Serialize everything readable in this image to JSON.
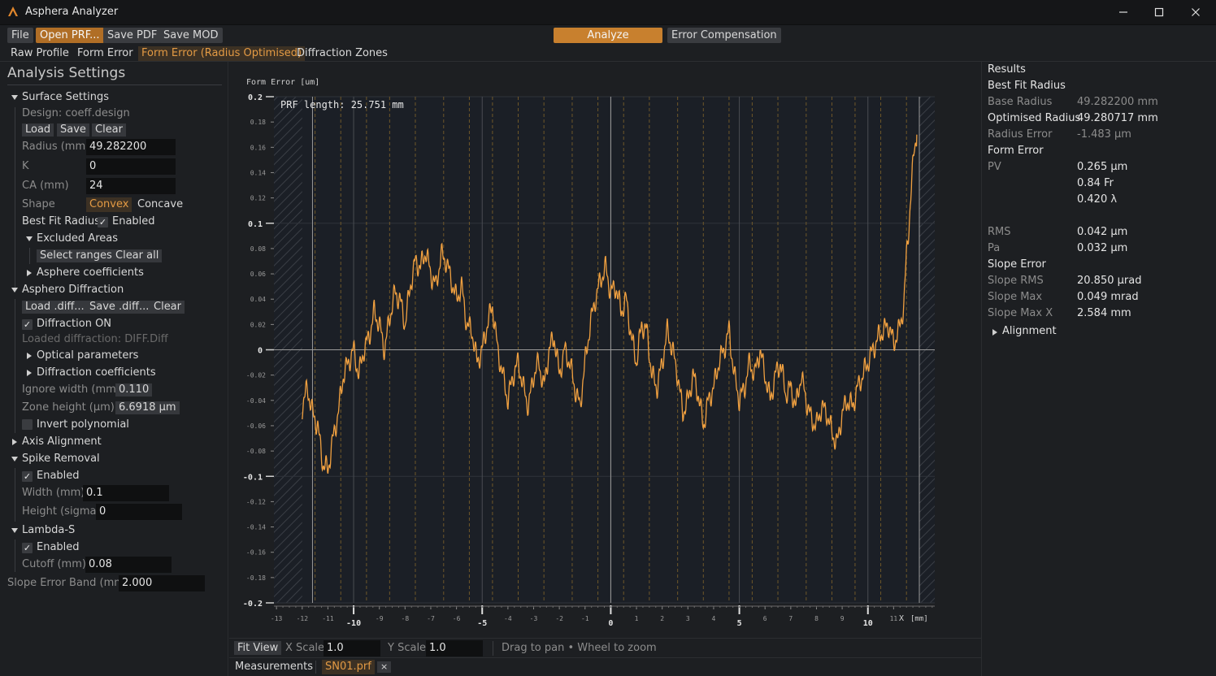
{
  "window": {
    "title": "Asphera Analyzer",
    "accent_color": "#c8802e",
    "controls": {
      "minimize": "minimize-icon",
      "maximize": "maximize-icon",
      "close": "close-icon"
    }
  },
  "toolbar": {
    "file": "File",
    "open_prf": "Open PRF...",
    "save_pdf": "Save PDF",
    "save_mod": "Save MOD",
    "analyze": "Analyze",
    "error_compensation": "Error Compensation"
  },
  "tabs": [
    "Raw Profile",
    "Form Error",
    "Form Error (Radius Optimised)",
    "Diffraction Zones"
  ],
  "active_tab": "Form Error (Radius Optimised)",
  "left": {
    "heading": "Analysis Settings",
    "surface": {
      "title": "Surface Settings",
      "design": "Design: coeff.design",
      "load": "Load",
      "save": "Save",
      "clear": "Clear",
      "radius_label": "Radius (mm)",
      "radius": "49.282200",
      "k_label": "K",
      "k": "0",
      "ca_label": "CA (mm)",
      "ca": "24",
      "shape_label": "Shape",
      "shape_convex": "Convex",
      "shape_concave": "Concave",
      "shape_selected": "Convex",
      "best_fit_label": "Best Fit Radius",
      "best_fit_enabled": "Enabled",
      "best_fit_checked": true,
      "excluded_title": "Excluded Areas",
      "select_ranges": "Select ranges",
      "clear_all": "Clear all",
      "asphere_coeffs": "Asphere coefficients"
    },
    "diffraction": {
      "title": "Asphero Diffraction",
      "load": "Load .diff...",
      "save": "Save .diff...",
      "clear": "Clear",
      "on_label": "Diffraction ON",
      "on_checked": true,
      "loaded": "Loaded diffraction: DIFF.Diff",
      "optical": "Optical parameters",
      "coeffs": "Diffraction coefficients",
      "ignore_label": "Ignore width (mm)",
      "ignore": "0.110",
      "zone_label": "Zone height (µm)",
      "zone": "6.6918 µm",
      "invert_label": "Invert polynomial",
      "invert_checked": false
    },
    "axis_alignment": "Axis Alignment",
    "spike": {
      "title": "Spike Removal",
      "enabled": "Enabled",
      "checked": true,
      "width_label": "Width (mm)",
      "width": "0.1",
      "height_label": "Height (sigma)",
      "height": "0"
    },
    "lambda": {
      "title": "Lambda-S",
      "enabled": "Enabled",
      "checked": true,
      "cutoff_label": "Cutoff (mm)",
      "cutoff": "0.08"
    },
    "slope_band_label": "Slope Error Band (mm)",
    "slope_band": "2.000"
  },
  "plot": {
    "annotation": "PRF length: 25.751 mm",
    "fit_view": "Fit View",
    "x_scale_label": "X Scale",
    "x_scale": "1.0",
    "y_scale_label": "Y Scale",
    "y_scale": "1.0",
    "hint": "Drag to pan • Wheel to zoom"
  },
  "status": {
    "tab": "Measurements",
    "file": "SN01.prf",
    "close": "×"
  },
  "results": {
    "title": "Results",
    "best_fit": "Best Fit Radius",
    "base_radius_label": "Base Radius",
    "base_radius": "49.282200 mm",
    "opt_radius_label": "Optimised Radius",
    "opt_radius": "49.280717 mm",
    "radius_error_label": "Radius Error",
    "radius_error": "-1.483 µm",
    "form_error": "Form Error",
    "pv_label": "PV",
    "pv_um": "0.265 µm",
    "pv_fr": "0.84 Fr",
    "pv_lambda": "0.420 λ",
    "rms_label": "RMS",
    "rms": "0.042 µm",
    "pa_label": "Pa",
    "pa": "0.032 µm",
    "slope_error": "Slope Error",
    "slope_rms_label": "Slope RMS",
    "slope_rms": "20.850 µrad",
    "slope_max_label": "Slope Max",
    "slope_max": "0.049 mrad",
    "slope_max_x_label": "Slope Max X",
    "slope_max_x": "2.584 mm",
    "alignment": "Alignment"
  },
  "chart_data": {
    "type": "line",
    "title": "",
    "ylabel": "Form Error [um]",
    "xlabel": "X [mm]",
    "xlim": [
      -13.1,
      12.6
    ],
    "ylim": [
      -0.2,
      0.2
    ],
    "y_major_ticks": [
      "0.2",
      "0.1",
      "0",
      "-0.1",
      "-0.2"
    ],
    "y_minor_ticks": [
      "0.18",
      "0.16",
      "0.14",
      "0.12",
      "0.08",
      "0.06",
      "0.04",
      "0.02",
      "-0.02",
      "-0.04",
      "-0.06",
      "-0.08",
      "-0.12",
      "-0.14",
      "-0.16",
      "-0.18"
    ],
    "x_major_ticks": [
      "-10",
      "-5",
      "0",
      "5",
      "10"
    ],
    "x_minor_ticks": [
      "-13",
      "-12",
      "-11",
      "-9",
      "-8",
      "-7",
      "-6",
      "-4",
      "-3",
      "-2",
      "-1",
      "1",
      "2",
      "3",
      "4",
      "6",
      "7",
      "8",
      "9",
      "11"
    ],
    "x_unit_tick": "[mm]",
    "excluded_regions": [
      [
        -13.1,
        -12.0
      ],
      [
        12.0,
        12.6
      ]
    ],
    "zone_boundaries": [
      -11.5,
      -10.5,
      -9.5,
      -8.6,
      -7.6,
      -6.5,
      -5.5,
      -4.6,
      -3.6,
      -2.6,
      -1.5,
      -0.5,
      0.5,
      1.5,
      2.6,
      3.6,
      4.6,
      5.5,
      6.5,
      7.6,
      8.6,
      9.5,
      10.5,
      11.5
    ],
    "series": [
      {
        "color": "#f0a040",
        "x": [
          -12.0,
          -11.8,
          -11.6,
          -11.4,
          -11.2,
          -11.0,
          -10.8,
          -10.6,
          -10.4,
          -10.2,
          -10.0,
          -9.8,
          -9.6,
          -9.4,
          -9.2,
          -9.0,
          -8.8,
          -8.6,
          -8.4,
          -8.2,
          -8.0,
          -7.8,
          -7.6,
          -7.4,
          -7.2,
          -7.0,
          -6.8,
          -6.6,
          -6.4,
          -6.2,
          -6.0,
          -5.8,
          -5.6,
          -5.4,
          -5.2,
          -5.0,
          -4.8,
          -4.6,
          -4.4,
          -4.2,
          -4.0,
          -3.8,
          -3.6,
          -3.4,
          -3.2,
          -3.0,
          -2.8,
          -2.6,
          -2.4,
          -2.2,
          -2.0,
          -1.8,
          -1.6,
          -1.4,
          -1.2,
          -1.0,
          -0.8,
          -0.6,
          -0.4,
          -0.2,
          0.0,
          0.2,
          0.4,
          0.6,
          0.8,
          1.0,
          1.2,
          1.4,
          1.6,
          1.8,
          2.0,
          2.2,
          2.4,
          2.6,
          2.8,
          3.0,
          3.2,
          3.4,
          3.6,
          3.8,
          4.0,
          4.2,
          4.4,
          4.6,
          4.8,
          5.0,
          5.2,
          5.4,
          5.6,
          5.8,
          6.0,
          6.2,
          6.4,
          6.6,
          6.8,
          7.0,
          7.2,
          7.4,
          7.6,
          7.8,
          8.0,
          8.2,
          8.4,
          8.6,
          8.8,
          9.0,
          9.2,
          9.4,
          9.6,
          9.8,
          10.0,
          10.2,
          10.4,
          10.6,
          10.8,
          11.0,
          11.2,
          11.4,
          11.5,
          11.6,
          11.7,
          11.8,
          11.9
        ],
        "y": [
          -0.045,
          -0.03,
          -0.05,
          -0.06,
          -0.09,
          -0.095,
          -0.07,
          -0.05,
          -0.02,
          -0.01,
          0.0,
          -0.02,
          0.0,
          0.01,
          0.03,
          0.02,
          0.0,
          0.025,
          0.045,
          0.04,
          0.02,
          0.05,
          0.07,
          0.065,
          0.078,
          0.06,
          0.05,
          0.075,
          0.07,
          0.055,
          0.04,
          0.05,
          0.02,
          0.015,
          -0.01,
          0.0,
          0.02,
          0.035,
          0.0,
          -0.02,
          -0.04,
          -0.02,
          -0.01,
          -0.03,
          -0.045,
          -0.02,
          -0.01,
          -0.03,
          0.0,
          0.01,
          -0.02,
          0.0,
          -0.01,
          -0.03,
          -0.045,
          -0.01,
          0.02,
          0.04,
          0.055,
          0.065,
          0.045,
          0.05,
          0.03,
          0.04,
          0.01,
          -0.01,
          0.02,
          0.015,
          -0.02,
          -0.03,
          -0.01,
          0.015,
          0.0,
          -0.02,
          -0.05,
          -0.04,
          -0.02,
          -0.035,
          -0.06,
          -0.04,
          -0.03,
          -0.01,
          0.0,
          0.015,
          -0.02,
          -0.04,
          -0.03,
          -0.01,
          -0.02,
          0.0,
          -0.02,
          -0.04,
          -0.02,
          -0.01,
          -0.035,
          -0.03,
          -0.045,
          -0.02,
          -0.04,
          -0.055,
          -0.06,
          -0.045,
          -0.05,
          -0.065,
          -0.075,
          -0.05,
          -0.04,
          -0.045,
          -0.03,
          -0.02,
          -0.01,
          0.0,
          0.01,
          0.015,
          0.02,
          0.005,
          0.015,
          0.035,
          0.075,
          0.1,
          0.13,
          0.16,
          0.17
        ]
      }
    ]
  }
}
